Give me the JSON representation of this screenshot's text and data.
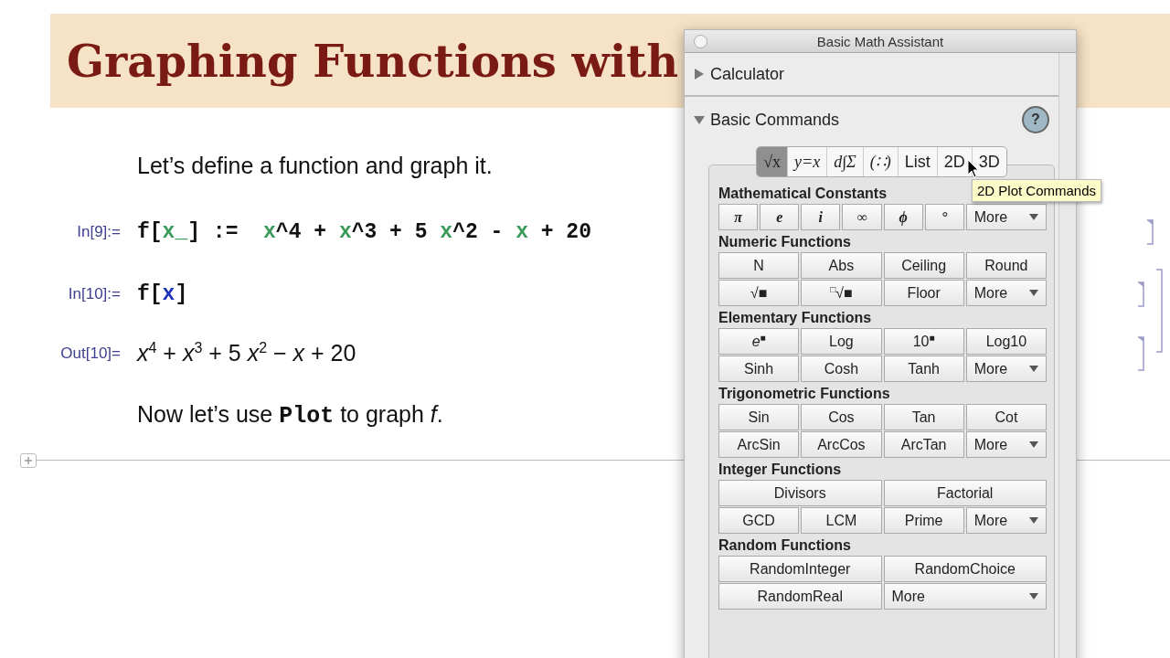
{
  "notebook": {
    "title": "Graphing Functions with",
    "cells": [
      {
        "kind": "text",
        "text": "Let’s define a function and graph it."
      },
      {
        "kind": "input",
        "label": "In[9]:=",
        "tokens": [
          {
            "text": "f[",
            "kind": "plain"
          },
          {
            "text": "x_",
            "kind": "pattern"
          },
          {
            "text": "] :=  ",
            "kind": "plain"
          },
          {
            "text": "x",
            "kind": "pattern"
          },
          {
            "text": "^4 + ",
            "kind": "plain"
          },
          {
            "text": "x",
            "kind": "pattern"
          },
          {
            "text": "^3 + 5 ",
            "kind": "plain"
          },
          {
            "text": "x",
            "kind": "pattern"
          },
          {
            "text": "^2 - ",
            "kind": "plain"
          },
          {
            "text": "x",
            "kind": "pattern"
          },
          {
            "text": " + 20",
            "kind": "plain"
          }
        ]
      },
      {
        "kind": "group",
        "cells": [
          {
            "kind": "input",
            "label": "In[10]:=",
            "tokens": [
              {
                "text": "f[",
                "kind": "plain"
              },
              {
                "text": "x",
                "kind": "global"
              },
              {
                "text": "]",
                "kind": "plain"
              }
            ]
          },
          {
            "kind": "output",
            "label": "Out[10]=",
            "text": "*x*$^{4}$ + *x*$^{3}$ + 5 *x*$^{2}$ − *x* + 20"
          }
        ]
      },
      {
        "kind": "text",
        "text": "Now let’s use **Plot** to graph *f*."
      }
    ]
  },
  "palette": {
    "title": "Basic Math Assistant",
    "sections": [
      {
        "label": "Calculator",
        "expanded": false
      },
      {
        "label": "Basic Commands",
        "expanded": true
      }
    ],
    "tabs": [
      {
        "label": "√x",
        "selected": true
      },
      {
        "label": "y=x",
        "selected": false
      },
      {
        "label": "d∫Σ",
        "selected": false
      },
      {
        "label": "(∷)",
        "selected": false
      },
      {
        "label": "List",
        "selected": false
      },
      {
        "label": "2D",
        "selected": false
      },
      {
        "label": "3D",
        "selected": false
      }
    ],
    "help": "?",
    "tooltip": "2D Plot Commands",
    "groups": [
      {
        "heading": "Mathematical Constants",
        "rows": [
          [
            {
              "label": "π",
              "kind": "symbol"
            },
            {
              "label": "e",
              "kind": "symbol"
            },
            {
              "label": "i",
              "kind": "symbol"
            },
            {
              "label": "∞",
              "kind": "symbol"
            },
            {
              "label": "ϕ",
              "kind": "symbol"
            },
            {
              "label": "°",
              "kind": "symbol"
            },
            {
              "label": "More",
              "kind": "menu",
              "wide": true
            }
          ]
        ]
      },
      {
        "heading": "Numeric Functions",
        "rows": [
          [
            {
              "label": "N",
              "kind": "plain"
            },
            {
              "label": "Abs",
              "kind": "plain"
            },
            {
              "label": "Ceiling",
              "kind": "plain"
            },
            {
              "label": "Round",
              "kind": "plain"
            }
          ],
          [
            {
              "label": "√■",
              "kind": "plain"
            },
            {
              "label": "$^{□}$√■",
              "kind": "plain"
            },
            {
              "label": "Floor",
              "kind": "plain"
            },
            {
              "label": "More",
              "kind": "menu"
            }
          ]
        ]
      },
      {
        "heading": "Elementary Functions",
        "rows": [
          [
            {
              "label": "*e*$^{■}$",
              "kind": "plain"
            },
            {
              "label": "Log",
              "kind": "plain"
            },
            {
              "label": "10$^{■}$",
              "kind": "plain"
            },
            {
              "label": "Log10",
              "kind": "plain"
            }
          ],
          [
            {
              "label": "Sinh",
              "kind": "plain"
            },
            {
              "label": "Cosh",
              "kind": "plain"
            },
            {
              "label": "Tanh",
              "kind": "plain"
            },
            {
              "label": "More",
              "kind": "menu"
            }
          ]
        ]
      },
      {
        "heading": "Trigonometric Functions",
        "rows": [
          [
            {
              "label": "Sin",
              "kind": "plain"
            },
            {
              "label": "Cos",
              "kind": "plain"
            },
            {
              "label": "Tan",
              "kind": "plain"
            },
            {
              "label": "Cot",
              "kind": "plain"
            }
          ],
          [
            {
              "label": "ArcSin",
              "kind": "plain"
            },
            {
              "label": "ArcCos",
              "kind": "plain"
            },
            {
              "label": "ArcTan",
              "kind": "plain"
            },
            {
              "label": "More",
              "kind": "menu"
            }
          ]
        ]
      },
      {
        "heading": "Integer Functions",
        "rows": [
          [
            {
              "label": "Divisors",
              "kind": "plain",
              "wide": true
            },
            {
              "label": "Factorial",
              "kind": "plain",
              "wide": true
            }
          ],
          [
            {
              "label": "GCD",
              "kind": "plain"
            },
            {
              "label": "LCM",
              "kind": "plain"
            },
            {
              "label": "Prime",
              "kind": "plain"
            },
            {
              "label": "More",
              "kind": "menu"
            }
          ]
        ]
      },
      {
        "heading": "Random Functions",
        "rows": [
          [
            {
              "label": "RandomInteger",
              "kind": "plain",
              "wide": true
            },
            {
              "label": "RandomChoice",
              "kind": "plain",
              "wide": true
            }
          ],
          [
            {
              "label": "RandomReal",
              "kind": "plain",
              "wide": true
            },
            {
              "label": "More",
              "kind": "menu",
              "wide": true
            }
          ]
        ]
      }
    ]
  }
}
